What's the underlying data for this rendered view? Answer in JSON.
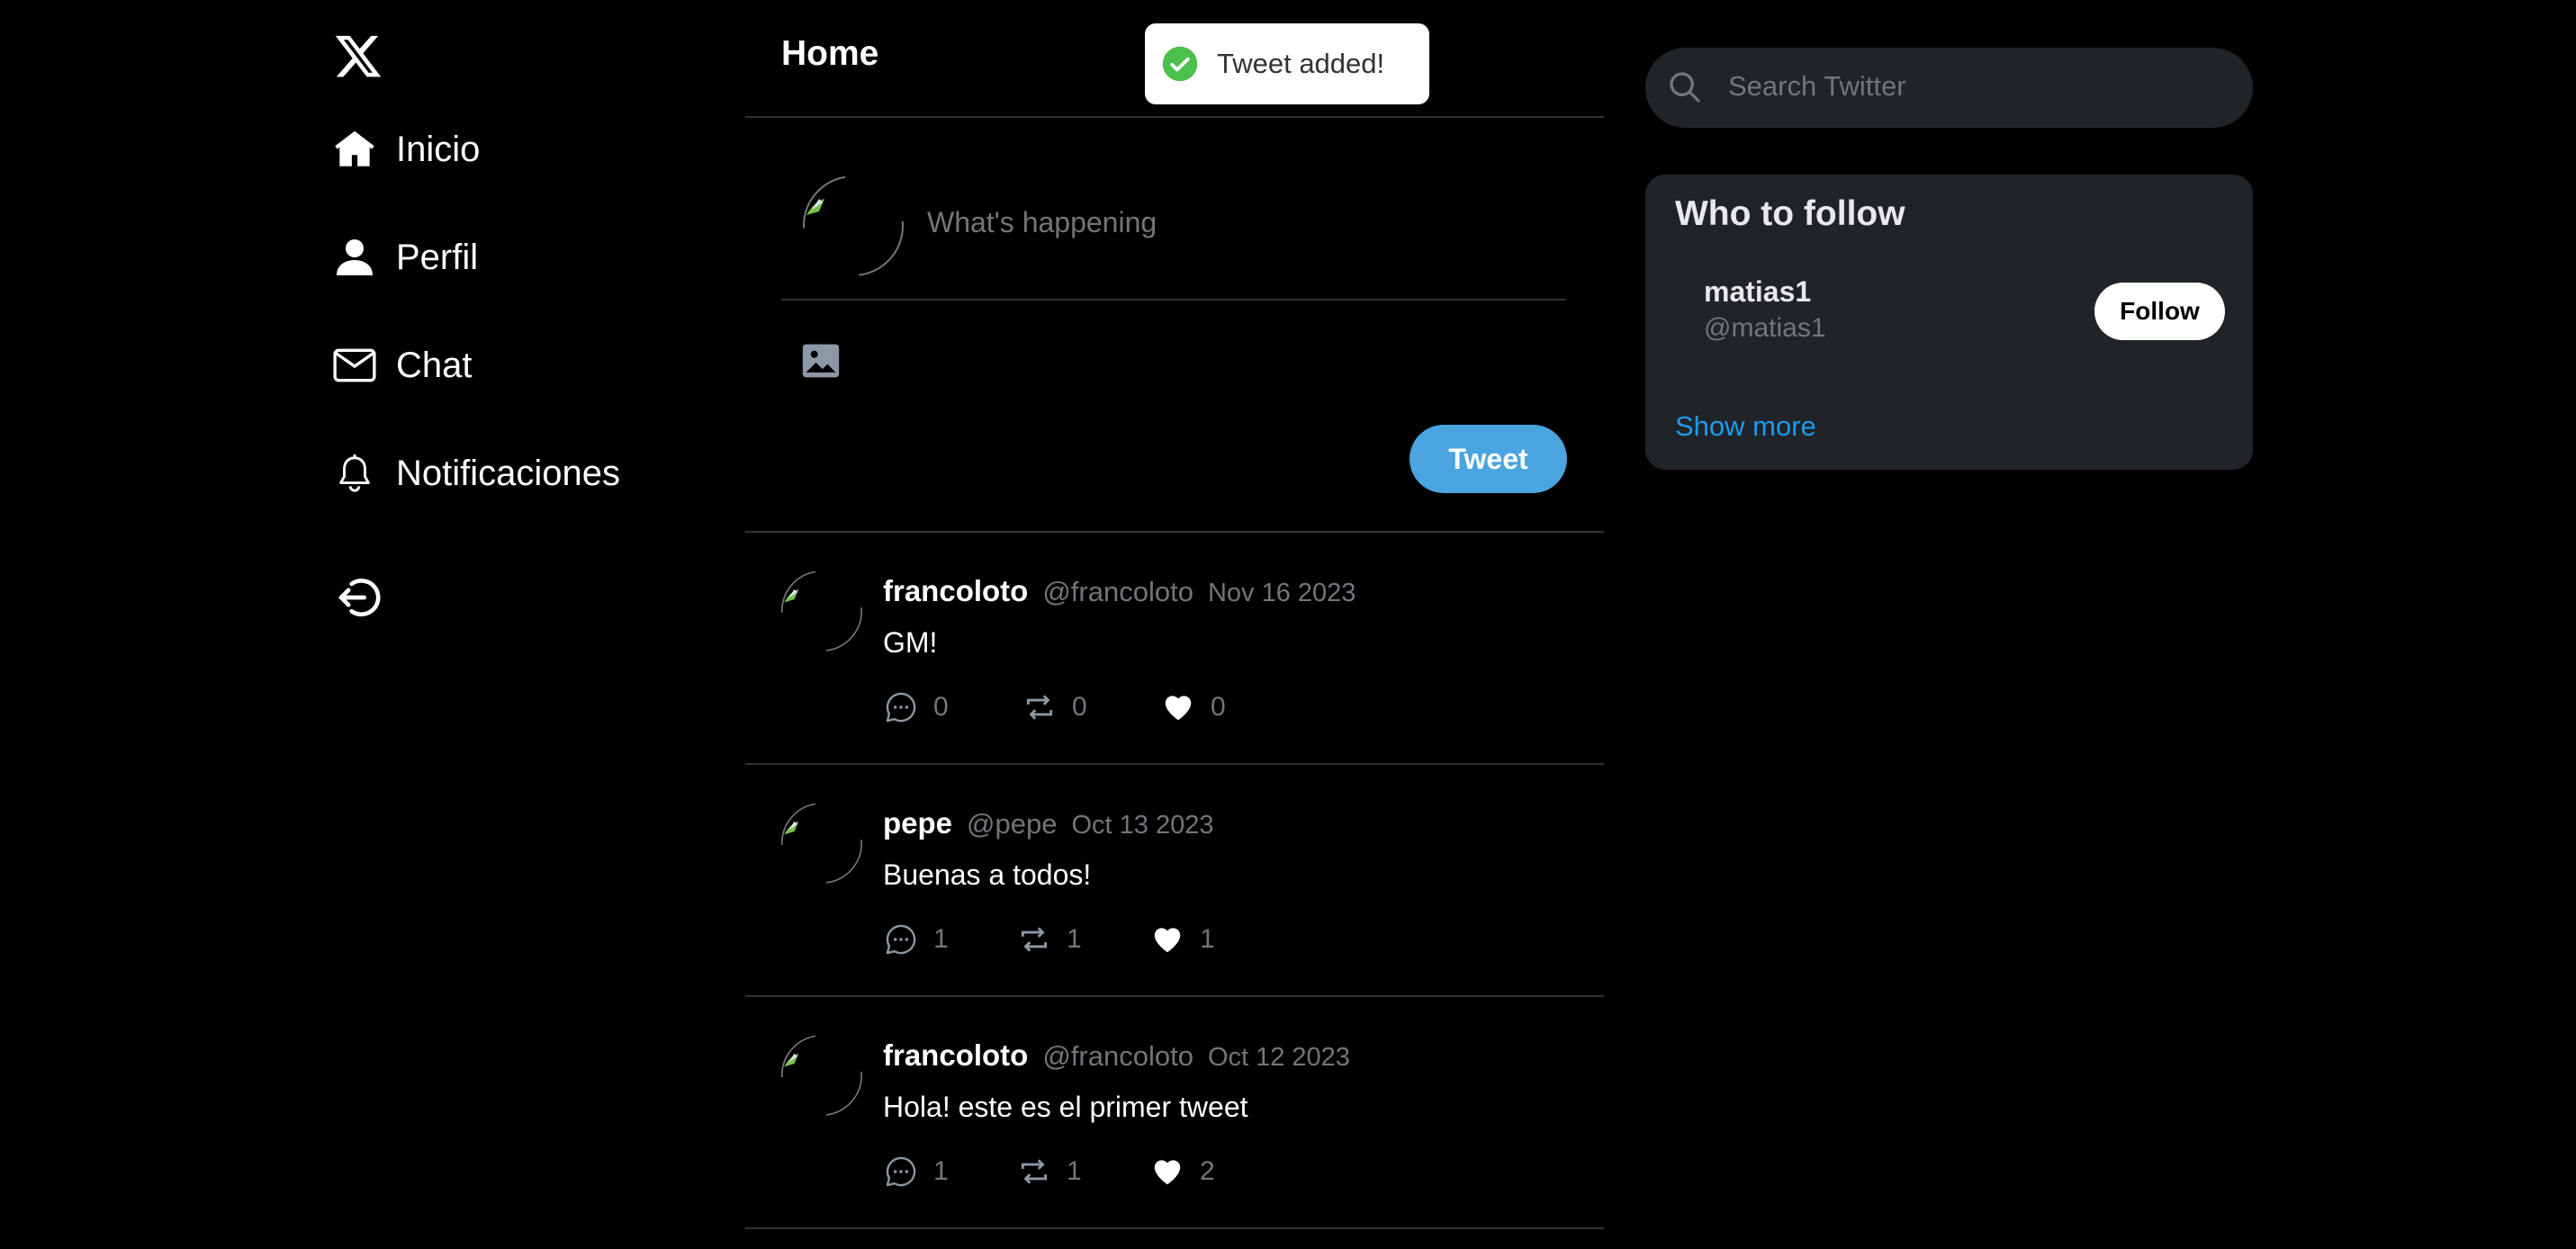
{
  "sidebar": {
    "logo": "x-logo-icon",
    "items": [
      {
        "label": "Inicio",
        "icon": "home-icon"
      },
      {
        "label": "Perfil",
        "icon": "user-icon"
      },
      {
        "label": "Chat",
        "icon": "mail-icon"
      },
      {
        "label": "Notificaciones",
        "icon": "bell-icon"
      }
    ],
    "logout_icon": "logout-icon"
  },
  "header": {
    "title": "Home"
  },
  "toast": {
    "message": "Tweet added!",
    "icon": "check-circle-icon",
    "color": "#4cbf4c"
  },
  "composer": {
    "placeholder": "What's happening",
    "image_icon": "image-icon",
    "tweet_label": "Tweet",
    "button_color": "#4aa4e0"
  },
  "tweets": [
    {
      "author": "francoloto",
      "handle": "@francoloto",
      "date": "Nov 16 2023",
      "content": "GM!",
      "replies": "0",
      "retweets": "0",
      "likes": "0"
    },
    {
      "author": "pepe",
      "handle": "@pepe",
      "date": "Oct 13 2023",
      "content": "Buenas a todos!",
      "replies": "1",
      "retweets": "1",
      "likes": "1"
    },
    {
      "author": "francoloto",
      "handle": "@francoloto",
      "date": "Oct 12 2023",
      "content": "Hola! este es el primer tweet",
      "replies": "1",
      "retweets": "1",
      "likes": "2"
    }
  ],
  "search": {
    "placeholder": "Search Twitter",
    "icon": "search-icon"
  },
  "who_to_follow": {
    "title": "Who to follow",
    "users": [
      {
        "name": "matias1",
        "handle": "@matias1",
        "follow_label": "Follow"
      }
    ],
    "show_more": "Show more",
    "link_color": "#1d9bf0"
  }
}
